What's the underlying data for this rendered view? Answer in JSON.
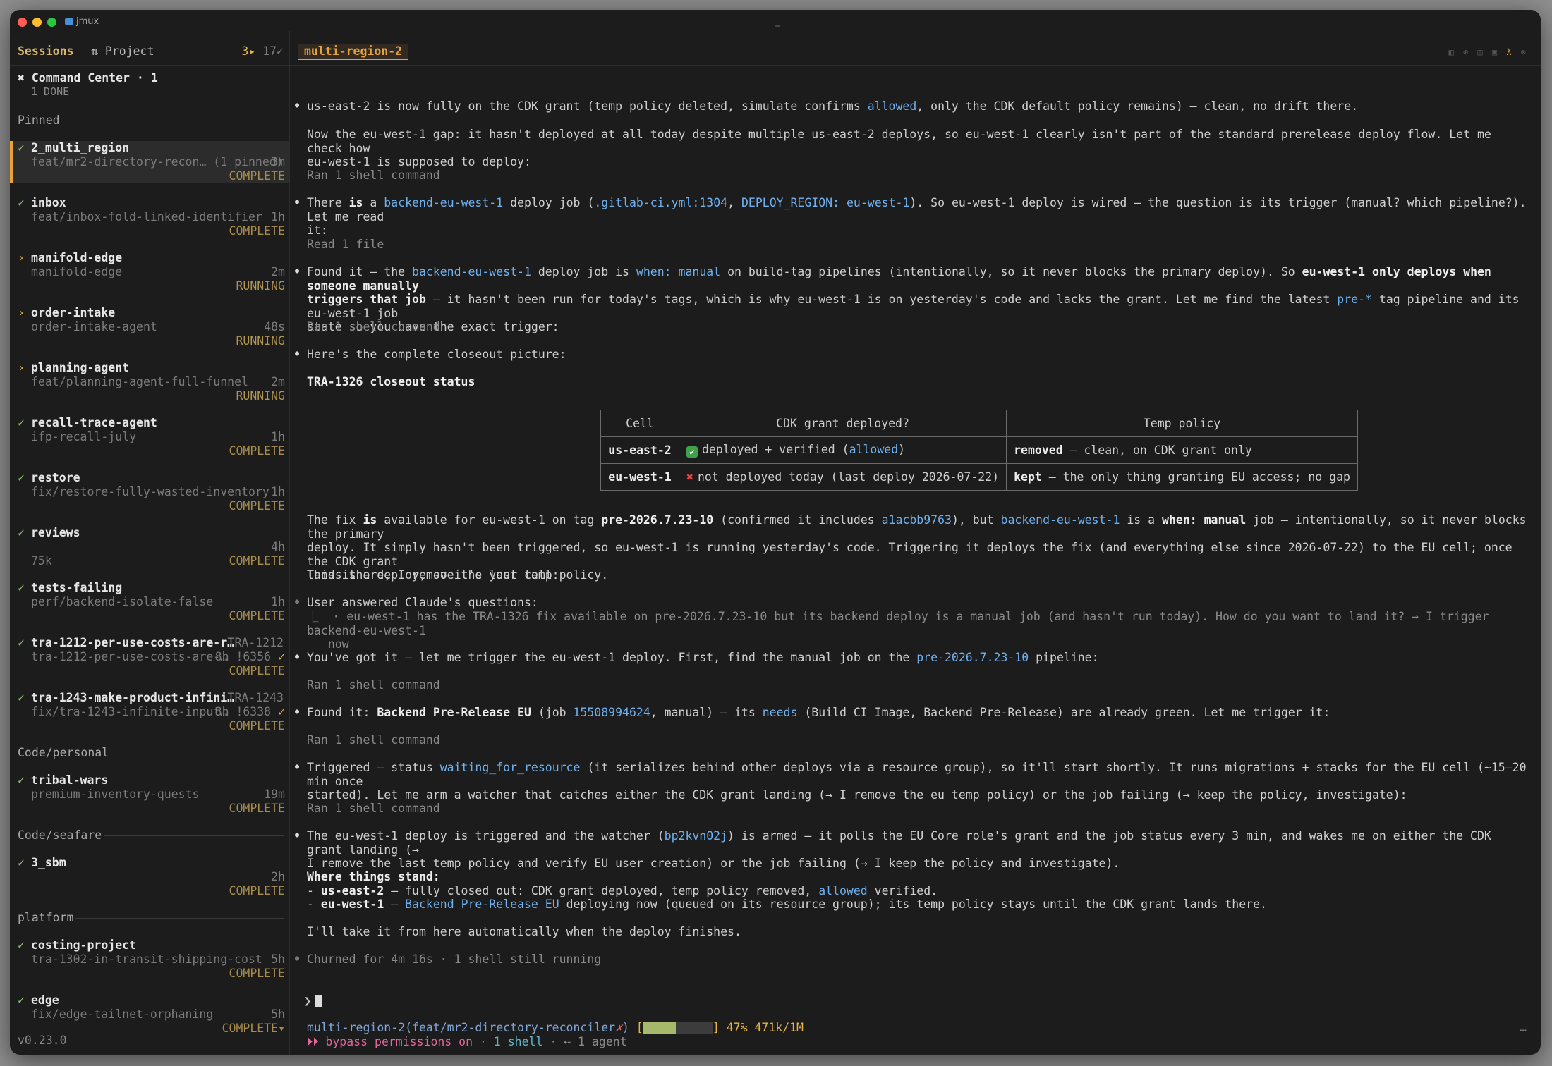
{
  "window": {
    "title": "jmux"
  },
  "sidebar": {
    "tab_sessions": "Sessions",
    "tab_project": "⇅ Project",
    "count_active": "3▸",
    "count_done": "17✓",
    "command_center": {
      "label": "✖ Command Center · 1",
      "sub": "1 DONE"
    },
    "groups": {
      "pinned": "Pinned",
      "personal": "Code/personal",
      "seafare": "Code/seafare",
      "platform": "platform"
    },
    "sessions": [
      {
        "marker": "✓",
        "name": "2_multi_region",
        "sub": "feat/mr2-directory-recon… (1 pinned)",
        "age": "3m",
        "status": "COMPLETE"
      },
      {
        "marker": "✓",
        "name": "inbox",
        "sub": "feat/inbox-fold-linked-identifier",
        "age": "1h",
        "status": "COMPLETE"
      },
      {
        "marker": "›",
        "name": "manifold-edge",
        "sub": "manifold-edge",
        "age": "2m",
        "status": "RUNNING"
      },
      {
        "marker": "›",
        "name": "order-intake",
        "sub": "order-intake-agent",
        "age": "48s",
        "status": "RUNNING"
      },
      {
        "marker": "›",
        "name": "planning-agent",
        "sub": "feat/planning-agent-full-funnel",
        "age": "2m",
        "status": "RUNNING"
      },
      {
        "marker": "✓",
        "name": "recall-trace-agent",
        "sub": "ifp-recall-july",
        "age": "1h",
        "status": "COMPLETE"
      },
      {
        "marker": "✓",
        "name": "restore",
        "sub": "fix/restore-fully-wasted-inventory",
        "age": "1h",
        "status": "COMPLETE"
      },
      {
        "marker": "✓",
        "name": "reviews",
        "sub": "",
        "age": "4h",
        "extra": "75k",
        "status": "COMPLETE"
      },
      {
        "marker": "✓",
        "name": "tests-failing",
        "sub": "perf/backend-isolate-false",
        "age": "1h",
        "status": "COMPLETE"
      },
      {
        "marker": "✓",
        "name": "tra-1212-per-use-costs-are-r…",
        "tag": "TRA-1212",
        "sub": "tra-1212-per-use-costs-are-…",
        "age": "8h !6356",
        "check": "✓",
        "status": "COMPLETE"
      },
      {
        "marker": "✓",
        "name": "tra-1243-make-product-infini…",
        "tag": "TRA-1243",
        "sub": "fix/tra-1243-infinite-input…",
        "age": "8h !6338",
        "check": "✓",
        "status": "COMPLETE"
      },
      {
        "marker": "✓",
        "name": "tribal-wars",
        "sub": "premium-inventory-quests",
        "age": "19m",
        "status": "COMPLETE"
      },
      {
        "marker": "✓",
        "name": "3_sbm",
        "sub": "",
        "age": "2h",
        "status": "COMPLETE"
      },
      {
        "marker": "✓",
        "name": "costing-project",
        "sub": "tra-1302-in-transit-shipping-cost",
        "age": "5h",
        "status": "COMPLETE"
      },
      {
        "marker": "✓",
        "name": "edge",
        "sub": "fix/edge-tailnet-orphaning",
        "age": "5h",
        "status": "COMPLETE▾"
      }
    ],
    "version": "v0.23.0"
  },
  "main": {
    "tab": "multi-region-2",
    "table": {
      "headers": [
        "Cell",
        "CDK grant deployed?",
        "Temp policy"
      ],
      "rows": [
        {
          "cell": "us-east-2",
          "icon": "✔",
          "a": "deployed + verified (",
          "a_hl": "allowed",
          "a2": ")",
          "b_bold": "removed",
          "b": " — clean, on CDK grant only"
        },
        {
          "cell": "eu-west-1",
          "icon": "✖",
          "a": "not deployed today (last deploy 2026-07-22)",
          "a_hl": "",
          "a2": "",
          "b_bold": "kept",
          "b": " — the only thing granting EU access; no gap"
        }
      ]
    }
  },
  "status": {
    "branch": "multi-region-2(feat/mr2-directory-reconciler",
    "dirty": "✗",
    "close": ")",
    "meter_open": "[",
    "meter_close": "]",
    "context_fill": 0.47,
    "context": "47% 471k/1M",
    "mode": "⏵⏵ bypass permissions on",
    "shells": "1 shell",
    "agents": "⇠ 1 agent",
    "sep": "·",
    "more": "…"
  }
}
